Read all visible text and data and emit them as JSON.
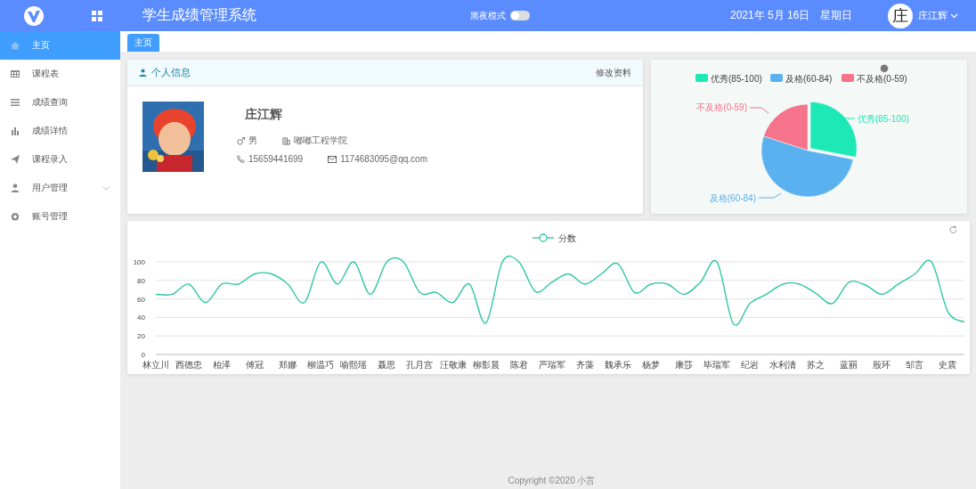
{
  "header": {
    "title": "学生成绩管理系统",
    "dark_mode": {
      "label": "黑夜模式",
      "on": false
    },
    "date": "2021年 5月 16日",
    "weekday": "星期日",
    "avatar_char": "庄",
    "user": "庄江辉"
  },
  "sidebar": {
    "items": [
      {
        "label": "主页",
        "selected": true,
        "kind": "link"
      },
      {
        "label": "课程表",
        "selected": false,
        "kind": "link"
      },
      {
        "label": "成绩查询",
        "selected": false,
        "kind": "link"
      },
      {
        "label": "成绩详情",
        "selected": false,
        "kind": "link"
      },
      {
        "label": "课程录入",
        "selected": false,
        "kind": "link"
      },
      {
        "label": "用户管理",
        "selected": false,
        "kind": "submenu"
      },
      {
        "label": "账号管理",
        "selected": false,
        "kind": "link"
      }
    ]
  },
  "tabs": [
    {
      "label": "主页",
      "selected": true
    }
  ],
  "profile": {
    "title": "个人信息",
    "edit": "修改资料",
    "name": "庄江辉",
    "gender": "男",
    "school": "嘟嘟工程学院",
    "phone": "15659441699",
    "email": "1174683095@qq.com"
  },
  "pie": {
    "legend": [
      {
        "label": "优秀(85-100)",
        "color": "#1de9b6"
      },
      {
        "label": "及格(60-84)",
        "color": "#5ab1ef"
      },
      {
        "label": "不及格(0-59)",
        "color": "#f5738b"
      }
    ],
    "slices": [
      {
        "label": "优秀(85-100)",
        "color": "#1de9b6"
      },
      {
        "label": "不及格(0-59)",
        "color": "#f5738b"
      },
      {
        "label": "及格(60-84)",
        "color": "#5ab1ef"
      }
    ]
  },
  "scores": {
    "chart_data": {
      "type": "line",
      "categories": [
        "林立川",
        null,
        "西德忠",
        null,
        "柏泽",
        null,
        "傅冠",
        null,
        "郑娜",
        null,
        "柳温巧",
        null,
        "喻熙瑶",
        null,
        "聂思",
        null,
        "孔月宫",
        null,
        "汪敬康",
        null,
        "柳影晨",
        null,
        "陈君",
        null,
        "严瑞军",
        null,
        "齐藻",
        null,
        "魏承乐",
        null,
        "杨梦",
        null,
        "康莎",
        null,
        "毕瑞军",
        null,
        "纪岩",
        null,
        "水利清",
        null,
        "苏之",
        null,
        "蓝丽",
        null,
        "殷环",
        null,
        "邹言",
        null,
        "史震",
        null
      ],
      "ylim": [
        0,
        100
      ],
      "yticks": [
        0,
        20,
        40,
        60,
        80,
        100
      ],
      "grid": true,
      "series": [
        {
          "name": "分数",
          "color": "#2ec7a5",
          "values": [
            65,
            65,
            76,
            56,
            76,
            76,
            87,
            87,
            76,
            56,
            100,
            76,
            100,
            65,
            100,
            100,
            67,
            67,
            56,
            76,
            34,
            100,
            100,
            68,
            78,
            87,
            76,
            87,
            98,
            67,
            76,
            76,
            65,
            78,
            100,
            33,
            55,
            65,
            76,
            76,
            66,
            55,
            78,
            75,
            65,
            76,
            87,
            100,
            46,
            35
          ]
        }
      ]
    }
  },
  "footer": "Copyright ©2020 小言"
}
